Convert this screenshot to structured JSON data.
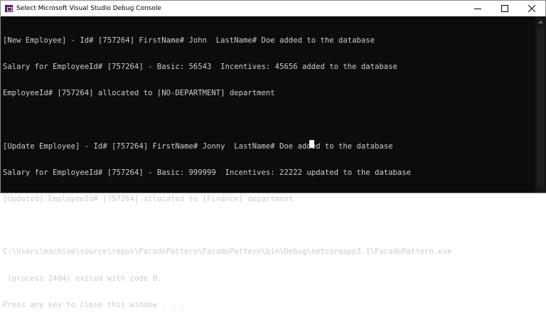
{
  "window": {
    "title": "Select Microsoft Visual Studio Debug Console",
    "icon": "visual-studio-icon",
    "controls": {
      "minimize": "minimize-icon",
      "maximize": "maximize-icon",
      "close": "close-icon"
    }
  },
  "console": {
    "lines": [
      "[New Employee] - Id# [757264] FirstName# John  LastName# Doe added to the database",
      "Salary for EmployeeId# [757264] - Basic: 56543  Incentives: 45656 added to the database",
      "EmployeeId# [757264] allocated to [NO-DEPARTMENT] department",
      "",
      "[Update Employee] - Id# [757264] FirstName# Jonny  LastName# Doe added to the database",
      "Salary for EmployeeId# [757264] - Basic: 999999  Incentives: 22222 updated to the database",
      "[Updated] EmployeeId# [757264] allocated to [Finance] department",
      "",
      "C:\\Users\\machine\\source\\repos\\FacadePattern\\FacadePattern\\bin\\Debug\\netcoreapp3.1\\FacadePattern.exe",
      " (process 2404) exited with code 0.",
      "Press any key to close this window . . ."
    ]
  },
  "colors": {
    "background": "#0c0c0c",
    "text": "#cccccc",
    "titlebar": "#ffffff"
  }
}
